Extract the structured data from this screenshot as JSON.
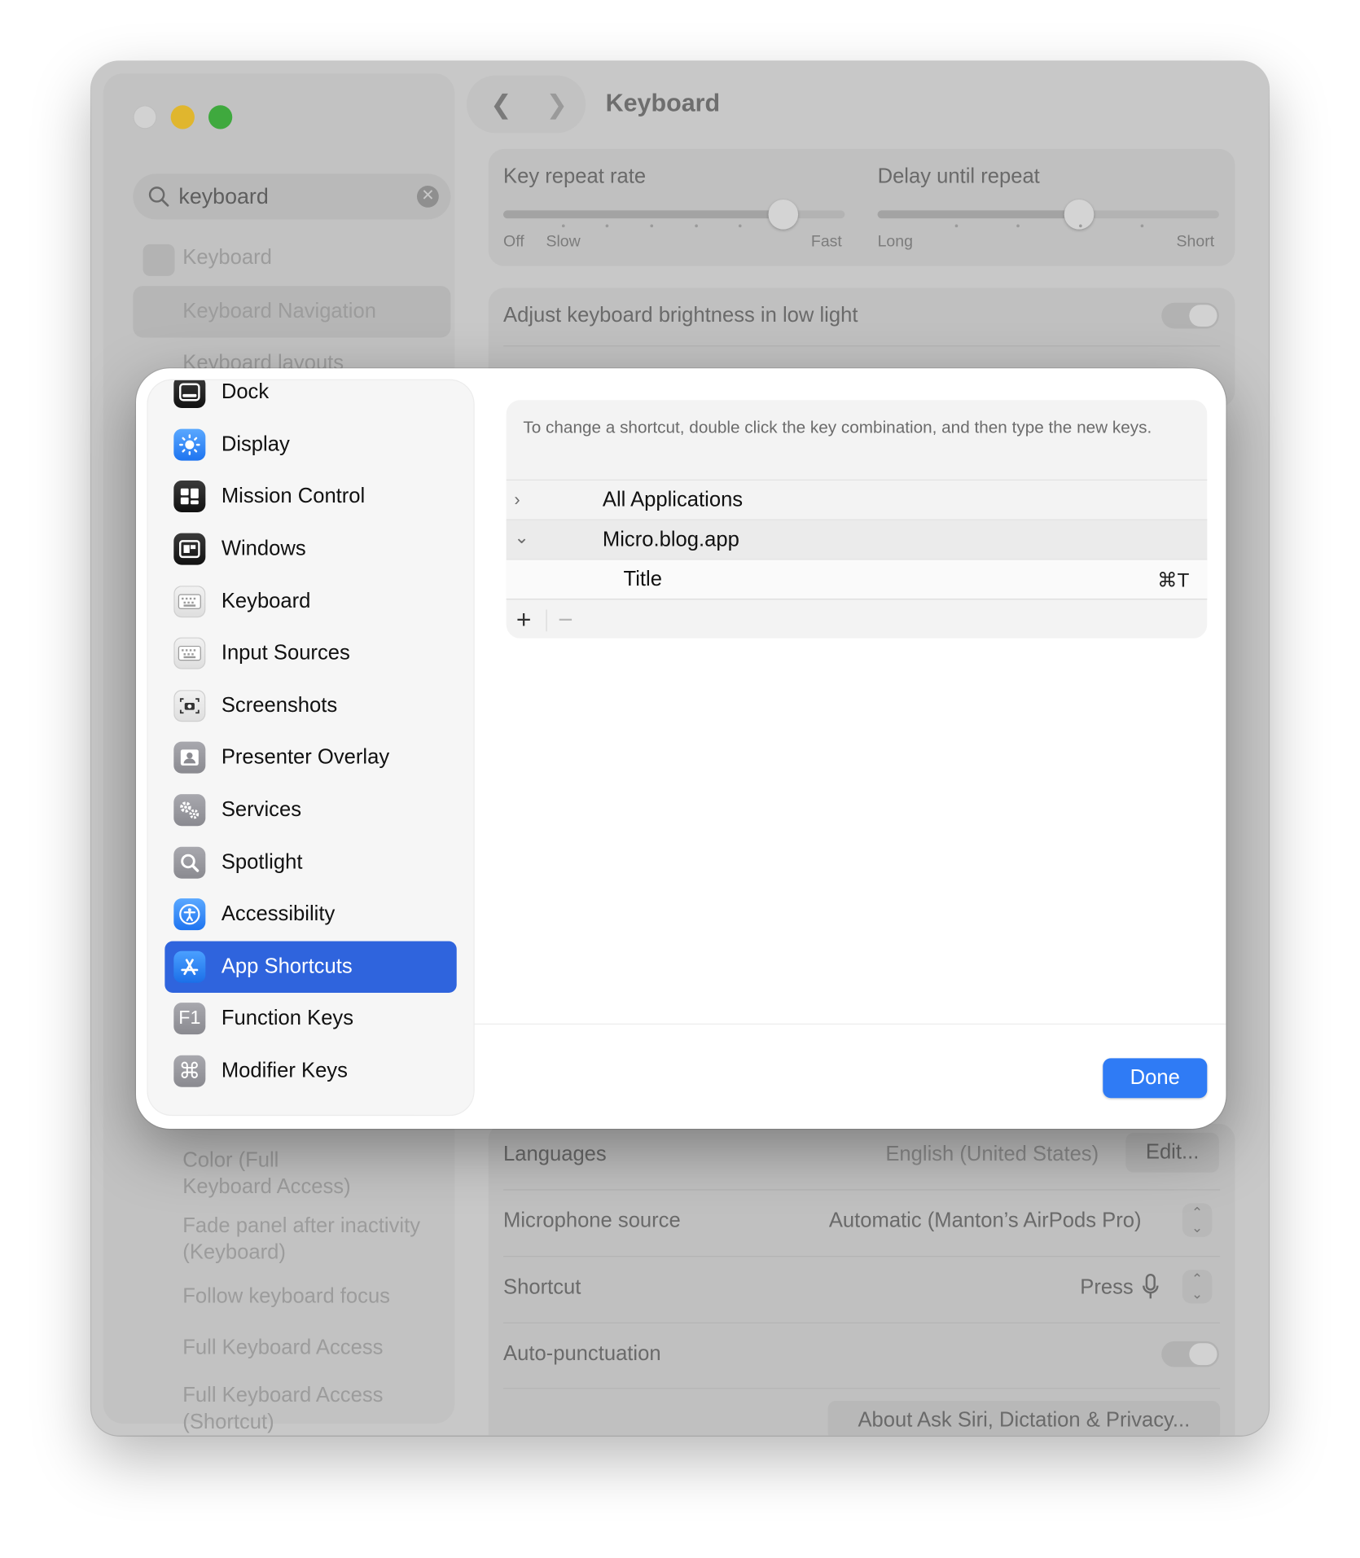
{
  "window": {
    "title": "Keyboard",
    "search": {
      "value": "keyboard"
    },
    "sidebar_top": [
      "Keyboard",
      "Keyboard Navigation",
      "Keyboard layouts"
    ],
    "sidebar_bottom": [
      "Color (Full\nKeyboard Access)",
      "Fade panel after inactivity\n(Keyboard)",
      "Follow keyboard focus",
      "Full Keyboard Access",
      "Full Keyboard Access\n(Shortcut)"
    ]
  },
  "settings": {
    "key_repeat_rate": {
      "label": "Key repeat rate",
      "min_label": "Off",
      "slow_label": "Slow",
      "max_label": "Fast",
      "level": 0.82
    },
    "delay_until_repeat": {
      "label": "Delay until repeat",
      "min_label": "Long",
      "max_label": "Short",
      "level": 0.59
    },
    "brightness": {
      "label": "Adjust keyboard brightness in low light",
      "on": false
    },
    "languages": {
      "label": "Languages",
      "value": "English (United States)",
      "button": "Edit..."
    },
    "microphone": {
      "label": "Microphone source",
      "value": "Automatic (Manton’s AirPods Pro)"
    },
    "shortcut": {
      "label": "Shortcut",
      "value": "Press"
    },
    "auto_punctuation": {
      "label": "Auto-punctuation",
      "on": false
    },
    "about_button": "About Ask Siri, Dictation & Privacy..."
  },
  "sheet": {
    "categories": [
      {
        "label": "Dock",
        "icon": "dock-icon"
      },
      {
        "label": "Display",
        "icon": "display-icon"
      },
      {
        "label": "Mission Control",
        "icon": "mission-control-icon"
      },
      {
        "label": "Windows",
        "icon": "windows-icon"
      },
      {
        "label": "Keyboard",
        "icon": "keyboard-icon"
      },
      {
        "label": "Input Sources",
        "icon": "input-sources-icon"
      },
      {
        "label": "Screenshots",
        "icon": "screenshots-icon"
      },
      {
        "label": "Presenter Overlay",
        "icon": "presenter-overlay-icon"
      },
      {
        "label": "Services",
        "icon": "services-icon"
      },
      {
        "label": "Spotlight",
        "icon": "spotlight-icon"
      },
      {
        "label": "Accessibility",
        "icon": "accessibility-icon"
      },
      {
        "label": "App Shortcuts",
        "icon": "app-shortcuts-icon",
        "selected": true
      },
      {
        "label": "Function Keys",
        "icon": "function-keys-icon"
      },
      {
        "label": "Modifier Keys",
        "icon": "modifier-keys-icon"
      }
    ],
    "hint": "To change a shortcut, double click the key combination, and then type the new keys.",
    "rows": [
      {
        "label": "All Applications",
        "expanded": false
      },
      {
        "label": "Micro.blog.app",
        "expanded": true
      },
      {
        "label": "Title",
        "shortcut": "⌘T"
      }
    ],
    "done_label": "Done",
    "accent_color": "#2f64dd"
  }
}
